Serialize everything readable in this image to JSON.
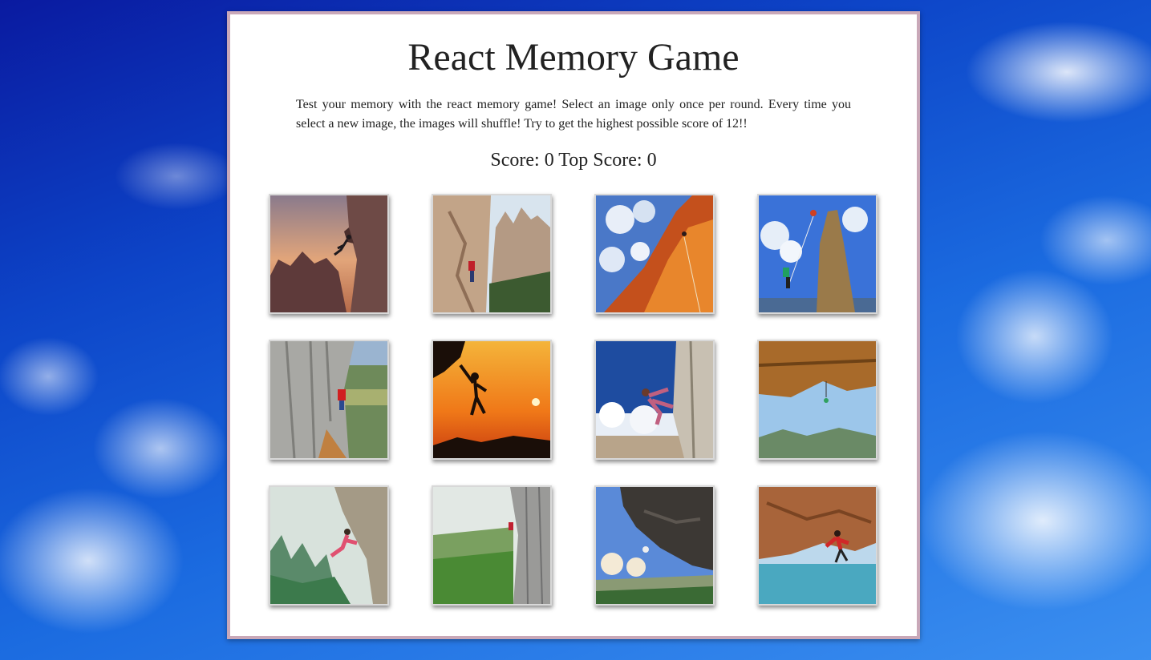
{
  "game": {
    "title": "React Memory Game",
    "description": "Test your memory with the react memory game! Select an image only once per round. Every time you select a new image, the images will shuffle! Try to get the highest possible score of 12!!",
    "score_label": "Score:",
    "score_value": "0",
    "top_score_label": "Top Score:",
    "top_score_value": "0"
  },
  "cards": [
    {
      "name": "climber-sunset-canyon-image"
    },
    {
      "name": "climber-rock-spires-image"
    },
    {
      "name": "climber-red-cliff-sky-image"
    },
    {
      "name": "climber-pinnacle-blue-sky-image"
    },
    {
      "name": "climber-gray-wall-valley-image"
    },
    {
      "name": "climber-silhouette-orange-sunset-image"
    },
    {
      "name": "climber-crack-clouds-image"
    },
    {
      "name": "climber-roof-overhang-image"
    },
    {
      "name": "climber-karst-mountains-image"
    },
    {
      "name": "climber-green-jungle-wall-image"
    },
    {
      "name": "climber-dark-overhang-image"
    },
    {
      "name": "climber-sea-cave-roof-image"
    }
  ]
}
